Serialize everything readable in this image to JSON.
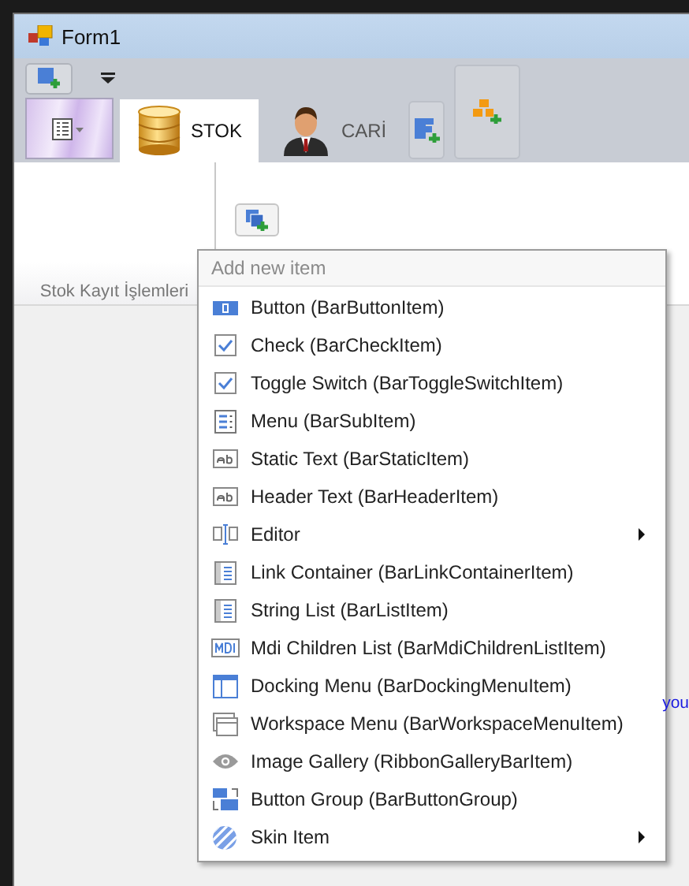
{
  "window": {
    "title": "Form1"
  },
  "ribbon": {
    "tabs": [
      {
        "label": "STOK",
        "selected": true,
        "kind": "database"
      },
      {
        "label": "CARİ",
        "selected": false,
        "kind": "person"
      }
    ],
    "group_label": "Stok Kayıt İşlemleri"
  },
  "side_text": "you",
  "popup_menu": {
    "header": "Add new item",
    "items": [
      {
        "label": "Button (BarButtonItem)",
        "kind": "button",
        "submenu": false
      },
      {
        "label": "Check (BarCheckItem)",
        "kind": "check",
        "submenu": false
      },
      {
        "label": "Toggle Switch (BarToggleSwitchItem)",
        "kind": "check",
        "submenu": false
      },
      {
        "label": "Menu (BarSubItem)",
        "kind": "menu",
        "submenu": false
      },
      {
        "label": "Static Text (BarStaticItem)",
        "kind": "text",
        "submenu": false
      },
      {
        "label": "Header Text (BarHeaderItem)",
        "kind": "text",
        "submenu": false
      },
      {
        "label": "Editor",
        "kind": "editor",
        "submenu": true
      },
      {
        "label": "Link Container (BarLinkContainerItem)",
        "kind": "list",
        "submenu": false
      },
      {
        "label": "String List (BarListItem)",
        "kind": "list",
        "submenu": false
      },
      {
        "label": "Mdi Children List (BarMdiChildrenListItem)",
        "kind": "mdi",
        "submenu": false
      },
      {
        "label": "Docking Menu (BarDockingMenuItem)",
        "kind": "docking",
        "submenu": false
      },
      {
        "label": "Workspace Menu (BarWorkspaceMenuItem)",
        "kind": "workspace",
        "submenu": false
      },
      {
        "label": "Image Gallery (RibbonGalleryBarItem)",
        "kind": "gallery",
        "submenu": false
      },
      {
        "label": "Button Group (BarButtonGroup)",
        "kind": "group",
        "submenu": false
      },
      {
        "label": "Skin Item",
        "kind": "skin",
        "submenu": true
      }
    ]
  }
}
